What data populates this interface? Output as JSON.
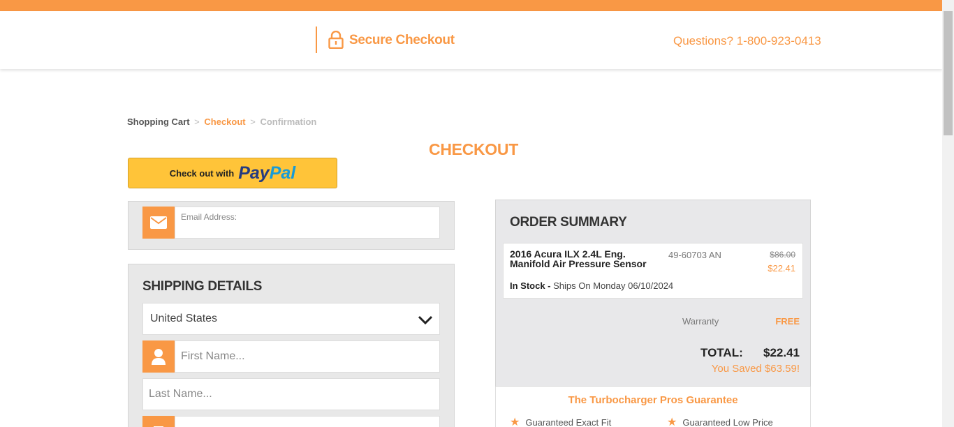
{
  "header": {
    "secure_label": "Secure Checkout",
    "phone": "Questions? 1-800-923-0413",
    "lock_icon": "lock-icon"
  },
  "breadcrumb": {
    "cart": "Shopping Cart",
    "sep": ">",
    "checkout": "Checkout",
    "confirmation": "Confirmation"
  },
  "page_title": "CHECKOUT",
  "paypal": {
    "prefix": "Check out with",
    "pay": "Pay",
    "pal": "Pal"
  },
  "email": {
    "label": "Email Address:",
    "icon": "envelope-icon"
  },
  "shipping": {
    "title": "SHIPPING DETAILS",
    "country": "United States",
    "first_name_placeholder": "First Name...",
    "last_name_placeholder": "Last Name...",
    "third_placeholder": ""
  },
  "summary": {
    "title": "ORDER SUMMARY",
    "item": {
      "name": "2016 Acura ILX 2.4L Eng. Manifold Air Pressure Sensor",
      "sku": "49-60703 AN",
      "old_price": "$86.00",
      "price": "$22.41",
      "stock": "In Stock -",
      "ships": "Ships On Monday 06/10/2024"
    },
    "warranty_label": "Warranty",
    "warranty_value": "FREE",
    "total_label": "TOTAL:",
    "total_value": "$22.41",
    "saved": "You Saved $63.59!"
  },
  "guarantee": {
    "title": "The Turbocharger Pros Guarantee",
    "items": [
      "Guaranteed Exact Fit",
      "Guaranteed Low Price"
    ]
  },
  "colors": {
    "accent": "#f99845",
    "paypal_yellow": "#ffc439",
    "panel": "#e8e8e8"
  }
}
